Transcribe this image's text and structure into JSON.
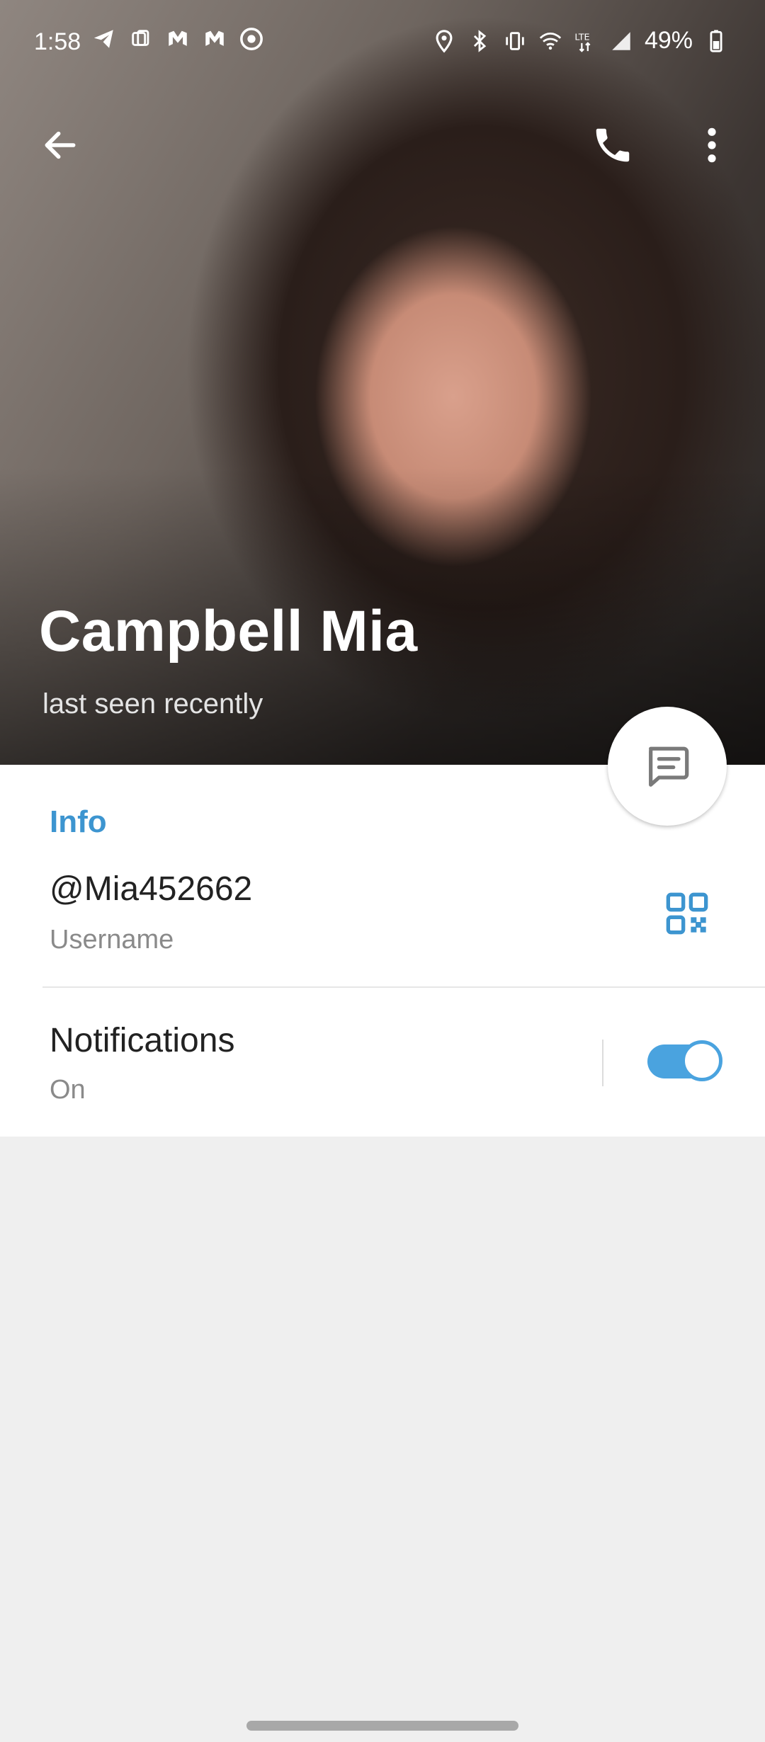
{
  "status_bar": {
    "time": "1:58",
    "battery_percent": "49%",
    "left_icons": [
      "telegram-icon",
      "app-icon",
      "malwarebytes-icon",
      "malwarebytes-icon",
      "chrome-icon"
    ],
    "right_icons": [
      "location-icon",
      "bluetooth-icon",
      "vibrate-icon",
      "wifi-icon",
      "lte-icon",
      "signal-icon",
      "battery-icon"
    ]
  },
  "toolbar": {
    "back_icon": "arrow-left-icon",
    "call_icon": "phone-icon",
    "menu_icon": "more-vertical-icon"
  },
  "profile": {
    "name": "Campbell Mia",
    "status": "last seen recently"
  },
  "info": {
    "section_title": "Info",
    "username": "@Mia452662",
    "username_label": "Username",
    "notifications_label": "Notifications",
    "notifications_value": "On",
    "notifications_enabled": true
  },
  "colors": {
    "accent": "#3d95d0",
    "toggle": "#4aa3df",
    "background": "#efefef"
  }
}
